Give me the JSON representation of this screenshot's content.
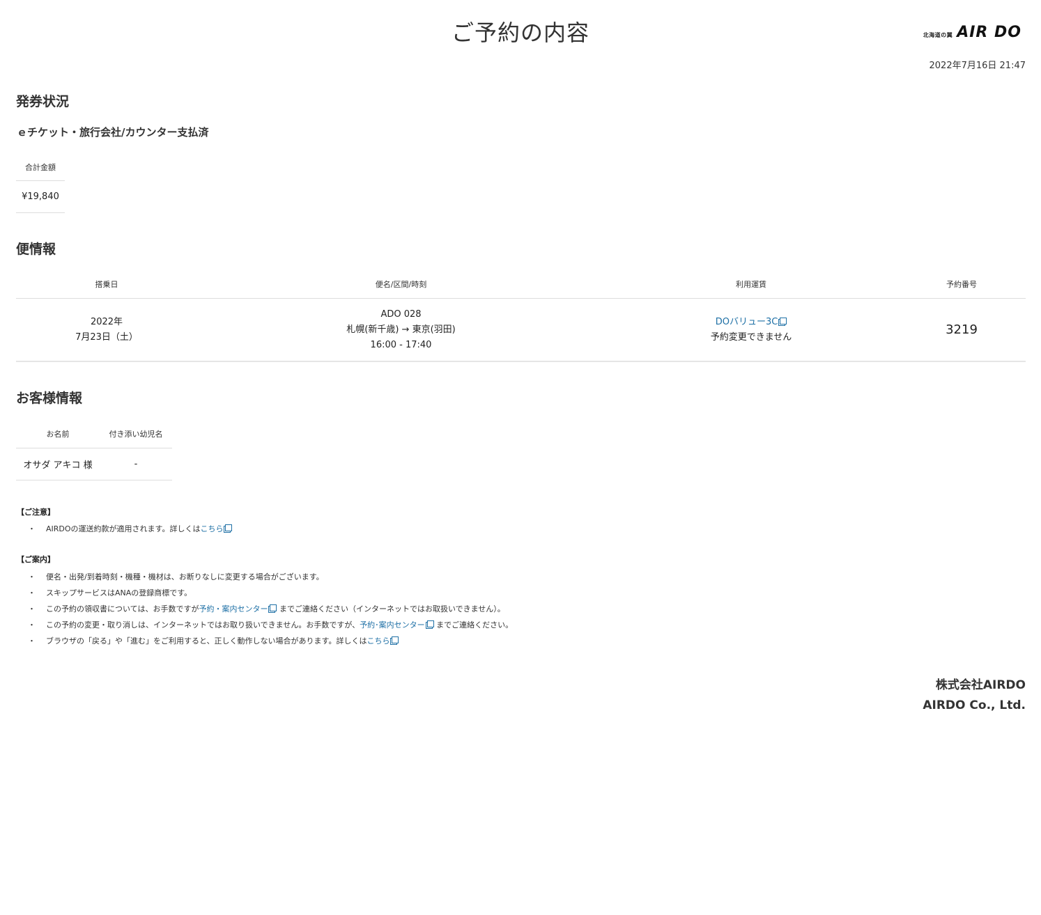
{
  "header": {
    "title": "ご予約の内容",
    "logo_tagline": "北海道の翼",
    "logo_text": "AIR DO",
    "issued_at": "2022年7月16日 21:47"
  },
  "ticket": {
    "heading": "発券状況",
    "status": "ｅチケット・旅行会社/カウンター支払済",
    "total_label": "合計金額",
    "total_value": "¥19,840"
  },
  "flight": {
    "heading": "便情報",
    "columns": [
      "搭乗日",
      "便名/区間/時刻",
      "利用運賃",
      "予約番号"
    ],
    "date_line1": "2022年",
    "date_line2": "7月23日（土）",
    "flight_no": "ADO 028",
    "route": "札幌(新千歳) → 東京(羽田)",
    "time": "16:00 - 17:40",
    "fare_name": "DOバリュー3C",
    "fare_note": "予約変更できません",
    "reservation_no": "3219"
  },
  "customer": {
    "heading": "お客様情報",
    "columns": [
      "お名前",
      "付き添い幼児名"
    ],
    "name": "オサダ アキコ 様",
    "infant": "-"
  },
  "caution": {
    "heading": "【ご注意】",
    "items": [
      {
        "text": "AIRDOの運送約款が適用されます。詳しくは",
        "link": "こちら",
        "after": ""
      }
    ]
  },
  "guide": {
    "heading": "【ご案内】",
    "items": [
      {
        "text": "便名・出発/到着時刻・機種・機材は、お断りなしに変更する場合がございます。",
        "link": "",
        "after": ""
      },
      {
        "text": "スキップサービスはANAの登録商標です。",
        "link": "",
        "after": ""
      },
      {
        "text": "この予約の領収書については、お手数ですが",
        "link": "予約・案内センター",
        "after": " までご連絡ください（インターネットではお取扱いできません）。"
      },
      {
        "text": "この予約の変更・取り消しは、インターネットではお取り扱いできません。お手数ですが、",
        "link": "予約･案内センター",
        "after": " までご連絡ください。"
      },
      {
        "text": "ブラウザの「戻る」や「進む」をご利用すると、正しく動作しない場合があります。詳しくは",
        "link": "こちら",
        "after": ""
      }
    ]
  },
  "footer": {
    "company_ja": "株式会社AIRDO",
    "company_en": "AIRDO Co., Ltd."
  },
  "colors": {
    "link": "#1d6fa5",
    "text": "#222222",
    "divider": "#dddddd"
  }
}
